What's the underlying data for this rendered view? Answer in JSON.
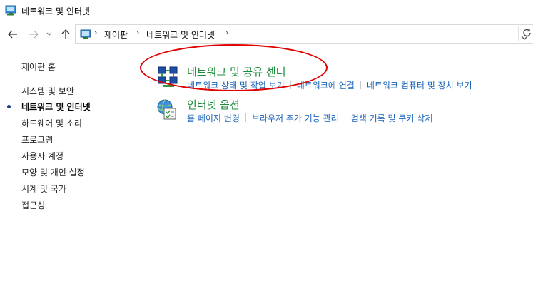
{
  "window": {
    "title": "네트워크 및 인터넷"
  },
  "address": {
    "crumbs": [
      "제어판",
      "네트워크 및 인터넷"
    ],
    "sep": "›"
  },
  "sidebar": {
    "home": "제어판 홈",
    "items": [
      {
        "label": "시스템 및 보안",
        "active": false
      },
      {
        "label": "네트워크 및 인터넷",
        "active": true
      },
      {
        "label": "하드웨어 및 소리",
        "active": false
      },
      {
        "label": "프로그램",
        "active": false
      },
      {
        "label": "사용자 계정",
        "active": false
      },
      {
        "label": "모양 및 개인 설정",
        "active": false
      },
      {
        "label": "시계 및 국가",
        "active": false
      },
      {
        "label": "접근성",
        "active": false
      }
    ]
  },
  "categories": [
    {
      "title": "네트워크 및 공유 센터",
      "icon": "network-sharing-center-icon",
      "tasks": [
        "네트워크 상태 및 작업 보기",
        "네트워크에 연결",
        "네트워크 컴퓨터 및 장치 보기"
      ]
    },
    {
      "title": "인터넷 옵션",
      "icon": "internet-options-icon",
      "tasks": [
        "홈 페이지 변경",
        "브라우저 추가 기능 관리",
        "검색 기록 및 쿠키 삭제"
      ]
    }
  ],
  "colors": {
    "title_green": "#1e8a3c",
    "link_blue": "#1a64b8",
    "highlight_red": "#e00000"
  }
}
